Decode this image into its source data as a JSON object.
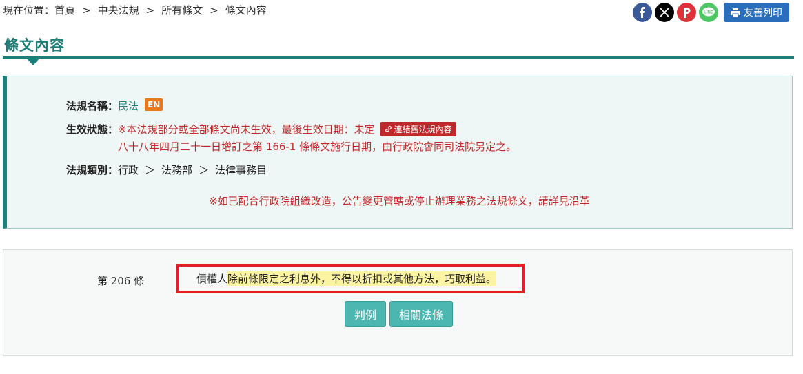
{
  "breadcrumb": {
    "lead": "現在位置：",
    "items": [
      "首頁",
      "中央法規",
      "所有條文",
      "條文內容"
    ],
    "separator": ">"
  },
  "share": {
    "icons": [
      "facebook-icon",
      "x-icon",
      "plurk-icon",
      "line-icon"
    ],
    "print_label": "友善列印"
  },
  "page_title": "條文內容",
  "info": {
    "name_label": "法規名稱：",
    "name_value": "民法",
    "en_badge": "EN",
    "status_label": "生效狀態：",
    "status_text": "※本法規部分或全部條文尚未生效，最後生效日期：未定",
    "old_link_label": "連結舊法規內容",
    "status_note": "八十八年四月二十一日增訂之第 166-1 條條文施行日期，由行政院會同司法院另定之。",
    "category_label": "法規類別：",
    "category": [
      "行政",
      "法務部",
      "法律事務目"
    ],
    "category_sep": "＞",
    "notice": "※如已配合行政院組織改造，公告變更管轄或停止辦理業務之法規條文，請詳見沿革"
  },
  "article": {
    "number": "第 206 條",
    "text_plain": "債權人",
    "text_highlight": "除前條限定之利息外，不得以折扣或其他方法，巧取利益。",
    "buttons": [
      "判例",
      "相關法條"
    ]
  },
  "colors": {
    "accent": "#1c7f7a",
    "red": "#c0292b",
    "highlight": "#fdf4a3",
    "button": "#4cb6b0"
  }
}
